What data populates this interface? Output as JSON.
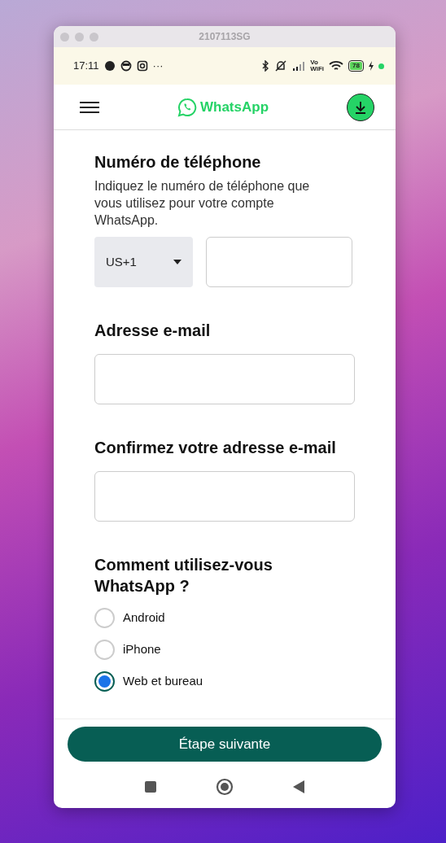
{
  "window": {
    "title": "2107113SG"
  },
  "status_bar": {
    "time": "17:11",
    "more": "···",
    "vowifi": [
      "Vo",
      "WiFi"
    ],
    "battery": "78"
  },
  "header": {
    "logo_text": "WhatsApp"
  },
  "phone": {
    "title": "Numéro de téléphone",
    "description": "Indiquez le numéro de téléphone que vous utilisez pour votre compte WhatsApp.",
    "country_code": "US+1"
  },
  "email": {
    "title": "Adresse e-mail"
  },
  "confirm_email": {
    "title": "Confirmez votre adresse e-mail"
  },
  "usage": {
    "title": "Comment utilisez-vous WhatsApp ?",
    "options": [
      {
        "label": "Android",
        "selected": false
      },
      {
        "label": "iPhone",
        "selected": false
      },
      {
        "label": "Web et bureau",
        "selected": true
      }
    ]
  },
  "next_button": "Étape suivante"
}
